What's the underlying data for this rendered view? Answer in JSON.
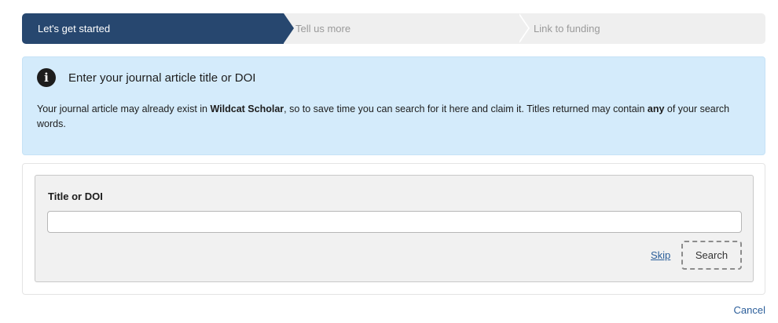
{
  "steps": [
    {
      "label": "Let's get started",
      "state": "active"
    },
    {
      "label": "Tell us more",
      "state": "inactive"
    },
    {
      "label": "Link to funding",
      "state": "inactive"
    }
  ],
  "info": {
    "icon": "info-circle-icon",
    "heading": "Enter your journal article title or DOI",
    "body_part1": "Your journal article may already exist in ",
    "body_bold1": "Wildcat Scholar",
    "body_part2": ", so to save time you can search for it here and claim it. Titles returned may contain ",
    "body_bold2": "any",
    "body_part3": " of your search words."
  },
  "search": {
    "field_label": "Title or DOI",
    "field_value": "",
    "skip_label": "Skip",
    "search_label": "Search"
  },
  "footer": {
    "cancel_label": "Cancel"
  },
  "colors": {
    "active_step": "#27476f",
    "info_bg": "#d4ebfb",
    "link": "#2b5e9a"
  }
}
